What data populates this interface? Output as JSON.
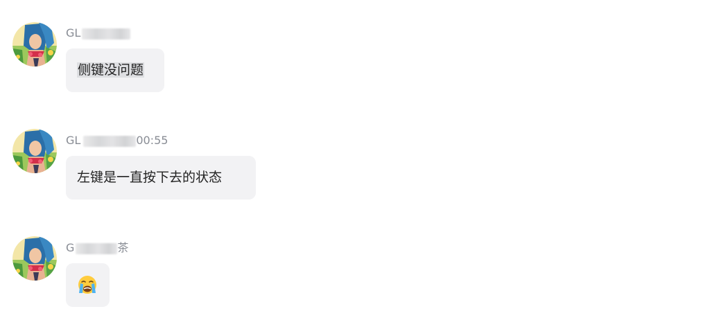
{
  "messages": [
    {
      "sender_visible": "GL",
      "text": "侧键没问题",
      "emoji": null
    },
    {
      "sender_visible": "GL",
      "time_suffix": "00:55",
      "text": "左键是一直按下去的状态",
      "emoji": null
    },
    {
      "sender_visible": "G",
      "sender_suffix": "茶",
      "text": null,
      "emoji": "loudly-crying-face-icon"
    }
  ],
  "colors": {
    "bubble": "#f2f2f4",
    "sender_text": "#888c94",
    "message_text": "#222222",
    "selection_highlight": "#dedfe2"
  }
}
